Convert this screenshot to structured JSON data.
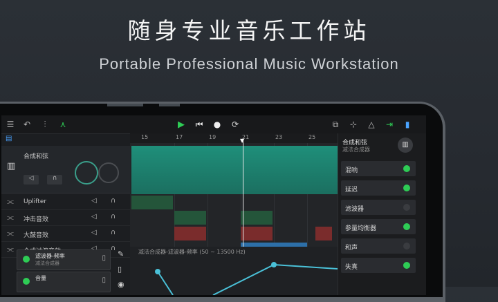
{
  "headline": "随身专业音乐工作站",
  "subline": "Portable Professional Music Workstation",
  "ruler": [
    "15",
    "17",
    "19",
    "21",
    "23",
    "25"
  ],
  "synth_track": {
    "name": "合成和弦"
  },
  "tracks": [
    {
      "name": "Uplifter"
    },
    {
      "name": "冲击音效"
    },
    {
      "name": "大鼓音效"
    },
    {
      "name": "合成过渡音效"
    }
  ],
  "fx_panel": {
    "title": "合成和弦",
    "subtitle": "减法合成器",
    "items": [
      {
        "label": "混响",
        "on": true
      },
      {
        "label": "延迟",
        "on": true
      },
      {
        "label": "滤波器",
        "on": false
      },
      {
        "label": "参量均衡器",
        "on": true
      },
      {
        "label": "和声",
        "on": false
      },
      {
        "label": "失真",
        "on": true
      }
    ]
  },
  "automation": {
    "items": [
      {
        "title": "滤波器-频率",
        "sub": "减法合成器"
      },
      {
        "title": "音量",
        "sub": ""
      }
    ],
    "lane_label": "减法合成器-滤波器-频率 (50 ~ 13500 Hz)"
  },
  "colors": {
    "accent_green": "#2ecc55",
    "clip_teal": "#1f8f7a",
    "clip_green": "#2a7a3a",
    "clip_red": "#a23c3c",
    "clip_blue": "#2d6fa8"
  },
  "icons": [
    "menu-icon",
    "undo-icon",
    "mixer-icon",
    "nodes-icon",
    "play-icon",
    "skip-back-icon",
    "record-icon",
    "loop-icon",
    "copy-icon",
    "split-icon",
    "metronome-icon",
    "export-icon",
    "panel-icon",
    "keyboard-icon",
    "waveform-icon",
    "speaker-icon",
    "headphone-icon",
    "trash-icon",
    "pencil-icon",
    "eye-icon"
  ]
}
